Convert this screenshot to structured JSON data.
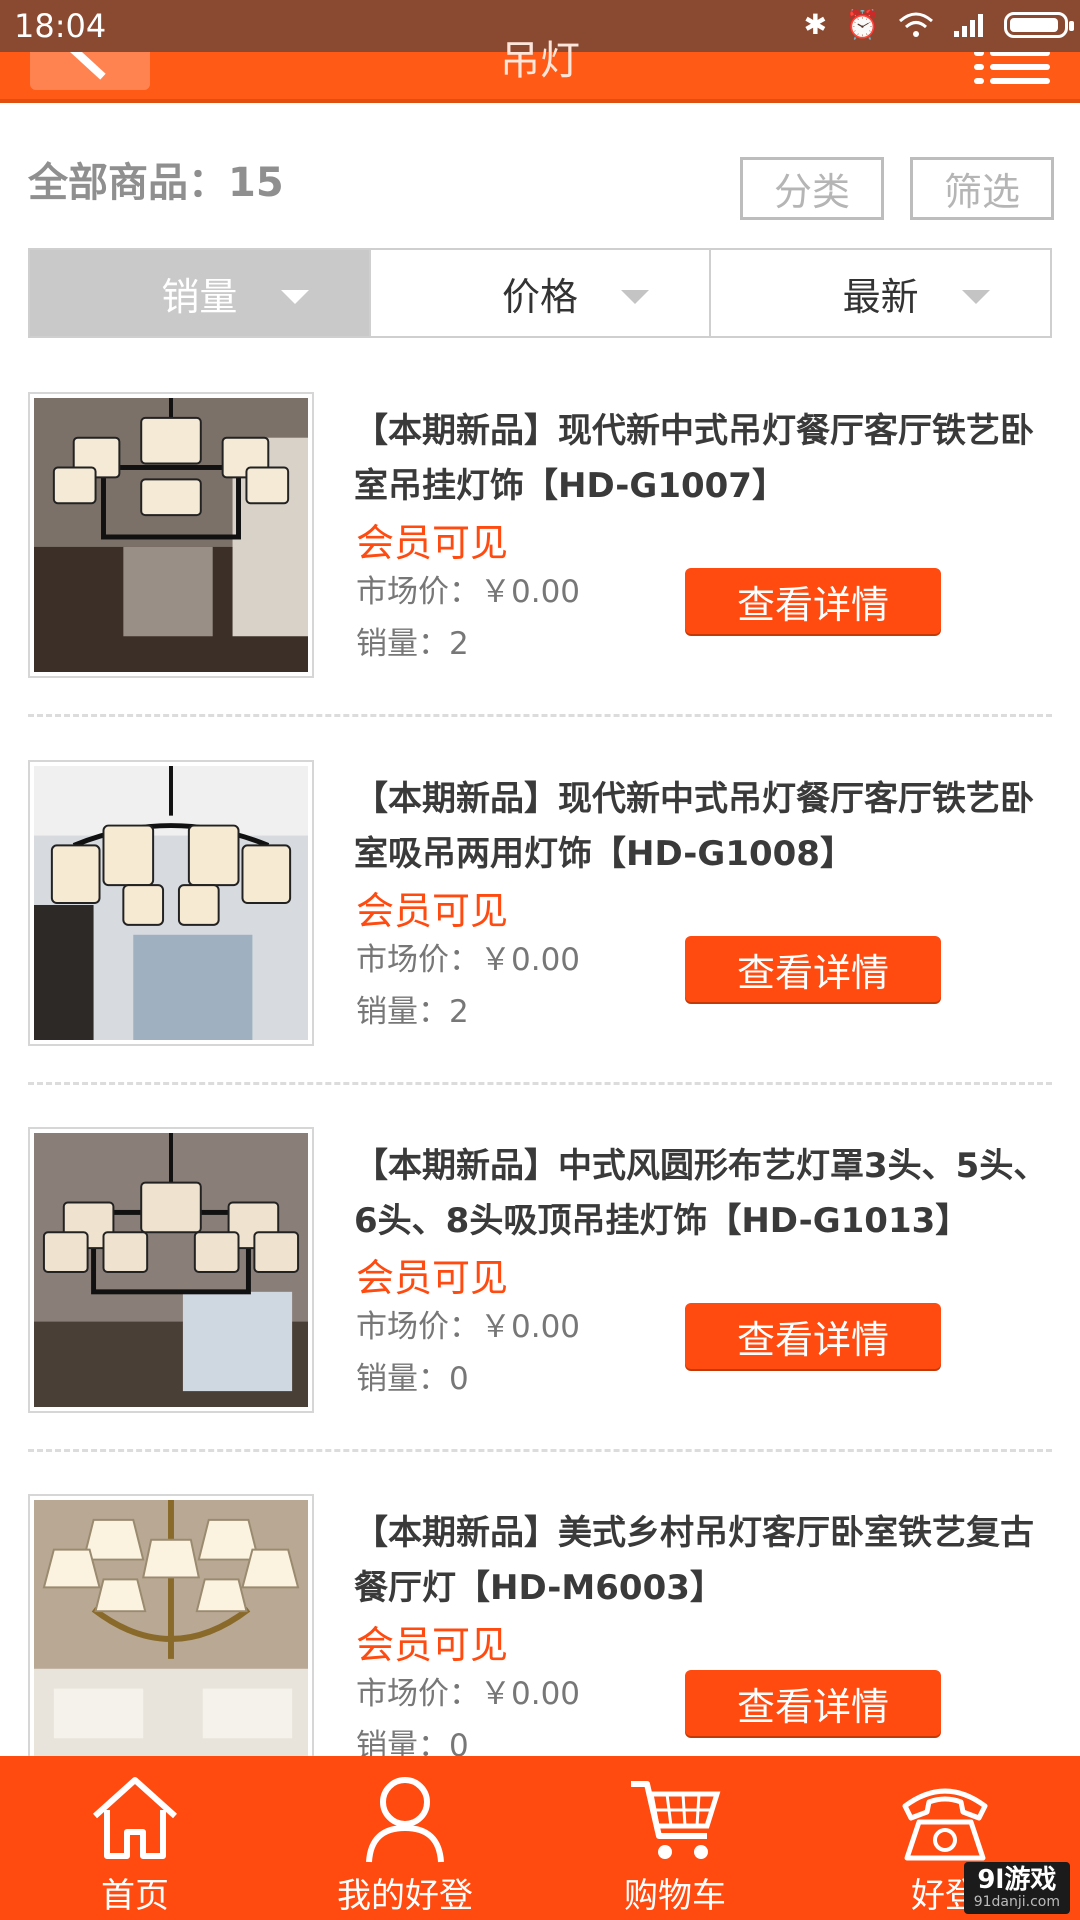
{
  "status_bar": {
    "time": "18:04"
  },
  "header": {
    "title": "吊灯"
  },
  "summary": {
    "text": "全部商品：15"
  },
  "buttons": {
    "category": "分类",
    "filter": "筛选"
  },
  "sort": {
    "items": [
      "销量",
      "价格",
      "最新"
    ]
  },
  "products": [
    {
      "title": "【本期新品】现代新中式吊灯餐厅客厅铁艺卧室吊挂灯饰【HD-G1007】",
      "member": "会员可见",
      "price": "市场价：￥0.00",
      "sales": "销量：2",
      "button": "查看详情"
    },
    {
      "title": "【本期新品】现代新中式吊灯餐厅客厅铁艺卧室吸吊两用灯饰【HD-G1008】",
      "member": "会员可见",
      "price": "市场价：￥0.00",
      "sales": "销量：2",
      "button": "查看详情"
    },
    {
      "title": "【本期新品】中式风圆形布艺灯罩3头、5头、6头、8头吸顶吊挂灯饰【HD-G1013】",
      "member": "会员可见",
      "price": "市场价：￥0.00",
      "sales": "销量：0",
      "button": "查看详情"
    },
    {
      "title": "【本期新品】美式乡村吊灯客厅卧室铁艺复古餐厅灯【HD-M6003】",
      "member": "会员可见",
      "price": "市场价：￥0.00",
      "sales": "销量：0",
      "button": "查看详情"
    }
  ],
  "bottom_nav": {
    "items": [
      {
        "label": "首页",
        "icon": "home-icon"
      },
      {
        "label": "我的好登",
        "icon": "user-icon"
      },
      {
        "label": "购物车",
        "icon": "cart-icon"
      },
      {
        "label": "好登",
        "icon": "phone-icon"
      }
    ]
  },
  "watermark": {
    "brand": "9l游戏",
    "site": "91danji.com"
  },
  "colors": {
    "accent": "#ff4a10",
    "header": "#ff5a16",
    "statusbar": "#8a4a32"
  }
}
